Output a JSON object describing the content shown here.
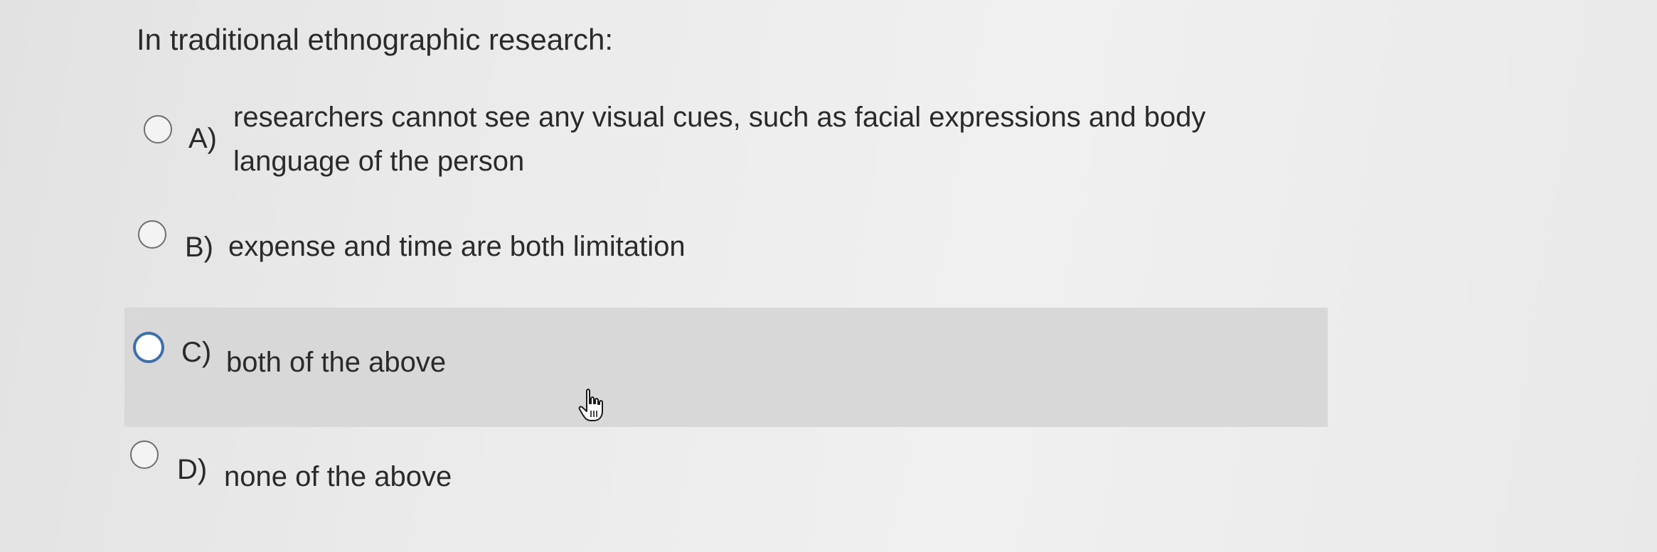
{
  "question": {
    "text": "In traditional ethnographic research:"
  },
  "options": [
    {
      "letter": "A)",
      "text_line1": "researchers cannot see any visual cues, such as facial expressions and body",
      "text_line2": "language of the person"
    },
    {
      "letter": "B)",
      "text": "expense and time are both limitation"
    },
    {
      "letter": "C)",
      "text": "both of the above",
      "highlighted": true
    },
    {
      "letter": "D)",
      "text": "none of the above"
    }
  ],
  "colors": {
    "highlight_bg": "#d8d8d8",
    "focus_ring": "#3f6fa8"
  },
  "cursor_icon": "hand-pointer-icon"
}
